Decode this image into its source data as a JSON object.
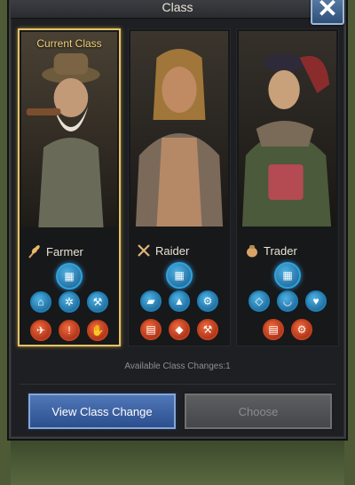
{
  "dialog": {
    "title": "Class",
    "close_glyph": "✕"
  },
  "cards": [
    {
      "name": "Farmer",
      "current_label": "Current Class",
      "class_icon": "wheat-icon",
      "abilities_row1": [
        "castle-icon"
      ],
      "abilities_row2": [
        "house-icon",
        "wheel-icon",
        "pickaxe-icon"
      ],
      "abilities_row3": [
        "dove-icon",
        "scroll-icon",
        "hand-icon"
      ]
    },
    {
      "name": "Raider",
      "class_icon": "crossed-swords-icon",
      "abilities_row1": [
        "castle-icon"
      ],
      "abilities_row2": [
        "cart-icon",
        "tent-icon",
        "gear-plus-icon"
      ],
      "abilities_row3": [
        "gold-bars-icon",
        "gem-icon",
        "pickaxe-icon"
      ]
    },
    {
      "name": "Trader",
      "class_icon": "money-bag-icon",
      "abilities_row1": [
        "castle-icon"
      ],
      "abilities_row2": [
        "diamond-icon",
        "boat-icon",
        "heart-gem-icon"
      ],
      "abilities_row3": [
        "gold-bars-icon",
        "gear-plus-icon"
      ]
    }
  ],
  "footer": {
    "available_text": "Available Class Changes:1",
    "view_button": "View Class Change",
    "choose_button": "Choose"
  },
  "colors": {
    "selected_border": "#e4c26a",
    "ability_blue": "#1d7fb8",
    "ability_red": "#c1421e",
    "button_blue": "#2c4f8e"
  }
}
